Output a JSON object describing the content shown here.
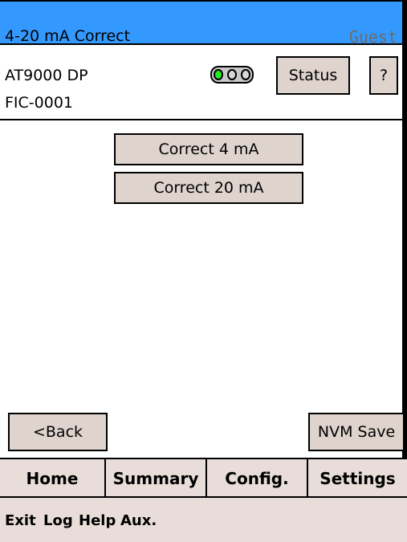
{
  "titlebar": {
    "title": "4-20 mA Correct",
    "user": "Guest"
  },
  "device": {
    "name": "AT9000 DP",
    "tag": "FIC-0001",
    "status_leds": {
      "count": 3,
      "active_index": 0,
      "active_color": "#22ee22"
    }
  },
  "header_buttons": {
    "status_label": "Status",
    "help_label": "?"
  },
  "actions": {
    "correct_4_label": "Correct 4 mA",
    "correct_20_label": "Correct 20 mA"
  },
  "bottom_actions": {
    "back_label": "<Back",
    "nvm_save_label": "NVM Save"
  },
  "nav": {
    "home": "Home",
    "summary": "Summary",
    "config": "Config.",
    "settings": "Settings"
  },
  "menu": {
    "exit": "Exit",
    "log": "Log",
    "help": "Help",
    "aux": "Aux."
  },
  "colors": {
    "titlebar": "#3399ff",
    "button": "#ded3cd",
    "navbar": "#e8ddd8"
  }
}
